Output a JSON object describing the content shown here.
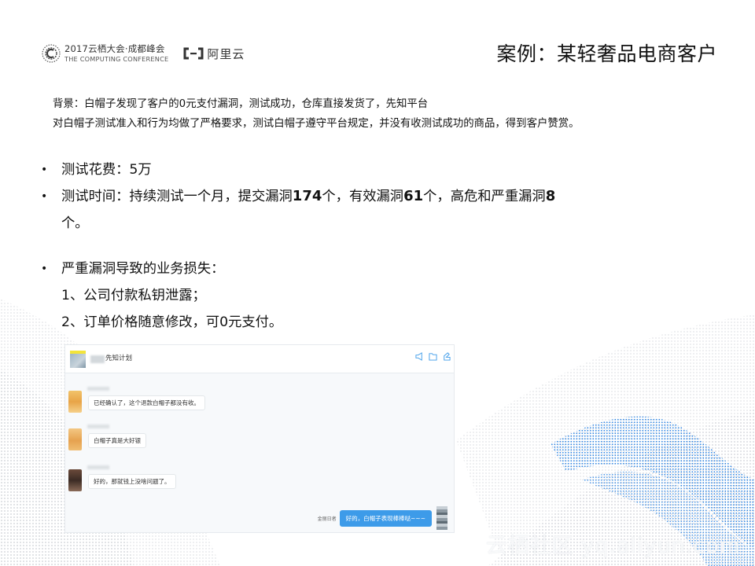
{
  "header": {
    "conference_line1": "2017云栖大会·成都峰会",
    "conference_line2": "THE COMPUTING CONFERENCE",
    "brand": "阿里云",
    "conference_logo_icon": "cloud-dots-logo-icon",
    "brand_logo_icon": "aliyun-bracket-logo-icon"
  },
  "slide": {
    "title": "案例：某轻奢品电商客户",
    "background_line1": "背景：白帽子发现了客户的0元支付漏洞，测试成功，仓库直接发货了，先知平台",
    "background_line2": "对白帽子测试准入和行为均做了严格要求，测试白帽子遵守平台规定，并没有收测试成功的商品，得到客户赞赏。"
  },
  "bullets": {
    "marker": "•",
    "cost": "测试花费：5万",
    "time_part1": "测试时间：持续测试一个月，提交漏洞",
    "time_num1": "174",
    "time_part2": "个，有效漏洞",
    "time_num2": "61",
    "time_part3": "个，高危和严重漏洞",
    "time_num3": "8",
    "time_part4": "个。",
    "loss_title": "严重漏洞导致的业务损失：",
    "loss_item1": "1、公司付款私钥泄露；",
    "loss_item2": "2、订单价格随意修改，可0元支付。"
  },
  "chat": {
    "title": "先知计划",
    "messages": [
      {
        "text": "已经确认了，这个退款白帽子都没有收。"
      },
      {
        "text": "白帽子真是大好银"
      },
      {
        "text": "好的，那就钱上没啥问题了。"
      }
    ],
    "reply_note": "金丽日者",
    "reply_text": "好的，白帽子表现棒棒哒~~~",
    "icons": [
      "megaphone-icon",
      "folder-icon",
      "share-icon"
    ]
  },
  "watermark": "云栖社区 yq.aliyun.com",
  "colors": {
    "wave_blue": "#1f6fe0",
    "wave_cyan": "#39c7f0",
    "chat_reply": "#3d9be9"
  }
}
